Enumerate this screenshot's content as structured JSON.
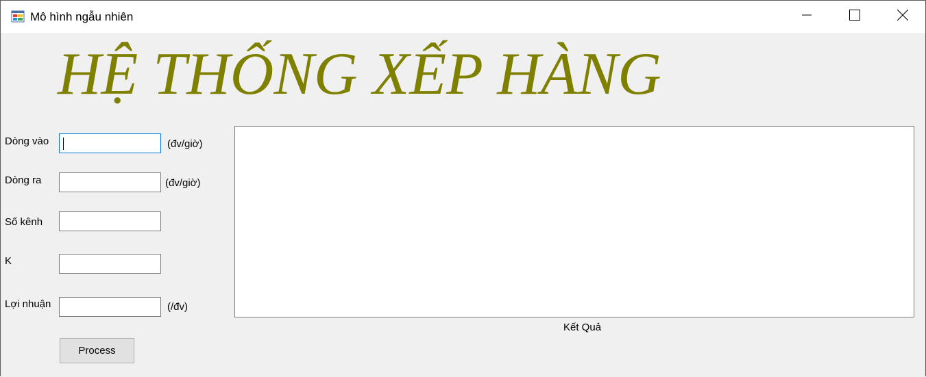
{
  "window": {
    "title": "Mô hình ngẫu nhiên",
    "icon": "app-form-icon",
    "controls": [
      "minimize-icon",
      "maximize-icon",
      "close-icon"
    ]
  },
  "banner": {
    "text": "HỆ THỐNG XẾP HÀNG",
    "color": "#808000"
  },
  "form": {
    "inflow": {
      "label": "Dòng vào",
      "value": "",
      "unit": "(đv/giờ)"
    },
    "outflow": {
      "label": "Dòng ra",
      "value": "",
      "unit": "(đv/giờ)"
    },
    "channels": {
      "label": "Số kênh",
      "value": ""
    },
    "k": {
      "label": "K",
      "value": ""
    },
    "profit": {
      "label": "Lợi nhuận",
      "value": "",
      "unit": "(/đv)"
    }
  },
  "result": {
    "label": "Kết Quả",
    "content": ""
  },
  "actions": {
    "process_label": "Process"
  }
}
